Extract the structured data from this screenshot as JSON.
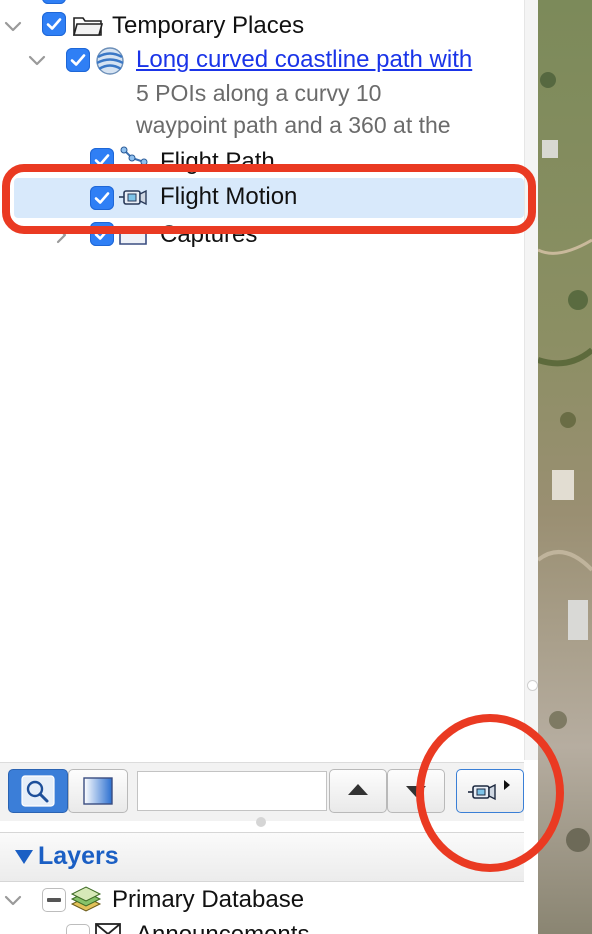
{
  "tree": {
    "temporary_places": "Temporary Places",
    "tour_title": "Long curved coastline path with",
    "tour_desc_line1": "5 POIs along a curvy 10",
    "tour_desc_line2": "waypoint path and a 360 at the",
    "flight_path": "Flight Path",
    "flight_motion": "Flight Motion",
    "captures": "Captures"
  },
  "toolbar": {
    "search_placeholder": "",
    "search_value": ""
  },
  "layers": {
    "header": "Layers",
    "primary_database": "Primary Database",
    "announcements": "Announcements"
  },
  "colors": {
    "checkbox_blue": "#2f7ff5",
    "link_blue": "#1a34e8",
    "selection_bg": "#d8e9fb",
    "annotation_red": "#ea3a22",
    "layers_header_text": "#1b5fc4"
  }
}
